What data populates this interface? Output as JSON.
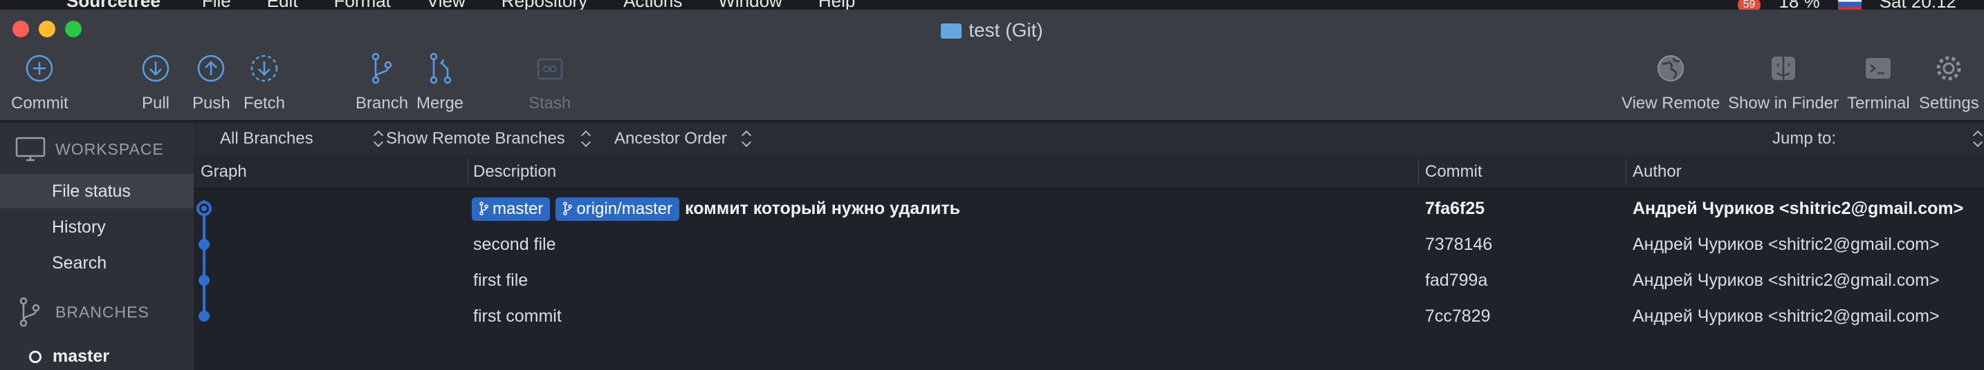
{
  "menubar": {
    "app_name": "Sourcetree",
    "items": [
      "File",
      "Edit",
      "Format",
      "View",
      "Repository",
      "Actions",
      "Window",
      "Help"
    ],
    "notification_badge": "59",
    "battery": "18 %",
    "clock": "Sat 20:12"
  },
  "window": {
    "title": "test (Git)"
  },
  "toolbar": {
    "commit": "Commit",
    "pull": "Pull",
    "push": "Push",
    "fetch": "Fetch",
    "branch": "Branch",
    "merge": "Merge",
    "stash": "Stash",
    "view_remote": "View Remote",
    "show_in_finder": "Show in Finder",
    "terminal": "Terminal",
    "settings": "Settings"
  },
  "sidebar": {
    "workspace_heading": "WORKSPACE",
    "workspace_items": [
      "File status",
      "History",
      "Search"
    ],
    "selected_item": "File status",
    "branches_heading": "BRANCHES",
    "branches": [
      "master"
    ]
  },
  "filters": {
    "branches": "All Branches",
    "remote": "Show Remote Branches",
    "order": "Ancestor Order",
    "jump_to": "Jump to:"
  },
  "columns": {
    "graph": "Graph",
    "description": "Description",
    "commit": "Commit",
    "author": "Author"
  },
  "commits": [
    {
      "tags": [
        "master",
        "origin/master"
      ],
      "description": "коммит который нужно удалить",
      "hash": "7fa6f25",
      "author": "Андрей Чуриков <shitric2@gmail.com>"
    },
    {
      "tags": [],
      "description": "second file",
      "hash": "7378146",
      "author": "Андрей Чуриков <shitric2@gmail.com>"
    },
    {
      "tags": [],
      "description": "first file",
      "hash": "fad799a",
      "author": "Андрей Чуриков <shitric2@gmail.com>"
    },
    {
      "tags": [],
      "description": "first commit",
      "hash": "7cc7829",
      "author": "Андрей Чуриков <shitric2@gmail.com>"
    }
  ],
  "colors": {
    "accent": "#2e6ed3",
    "tag_bg": "#2b69c4",
    "toolbar_icon": "#5a9ee6"
  }
}
